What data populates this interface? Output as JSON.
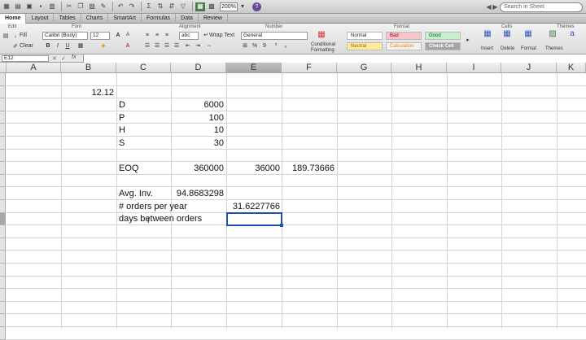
{
  "toolbar": {
    "zoom": "200%",
    "search_placeholder": "Search in Sheet",
    "help": "?"
  },
  "ribbon_tabs": [
    "Home",
    "Layout",
    "Tables",
    "Charts",
    "SmartArt",
    "Formulas",
    "Data",
    "Review"
  ],
  "ribbon": {
    "groups": {
      "edit": "Edit",
      "font": "Font",
      "alignment": "Alignment",
      "number": "Number",
      "format": "Format",
      "cells": "Cells",
      "themes": "Themes"
    },
    "fill_label": "Fill",
    "clear_label": "Clear",
    "font_name": "Calibri (Body)",
    "font_size": "12",
    "wrap_text": "Wrap Text",
    "number_format": "General",
    "conditional_formatting_1": "Conditional",
    "conditional_formatting_2": "Formatting",
    "styles": {
      "normal": "Normal",
      "bad": "Bad",
      "good": "Good",
      "neutral": "Neutral",
      "calculation": "Calculation",
      "check_cell": "Check Cell"
    },
    "insert": "Insert",
    "delete": "Delete",
    "format_btn": "Format",
    "themes_btn": "Themes",
    "abc": "abc",
    "align_label": "a",
    "bold": "B",
    "italic": "I",
    "underline": "U",
    "font_grow": "A",
    "font_shrink": "A",
    "font_color": "A",
    "percent": "%",
    "comma": "9",
    "fx": "fx",
    "style_color": "#e06b6b"
  },
  "name_box": "E12",
  "columns": [
    "A",
    "B",
    "C",
    "D",
    "E",
    "F",
    "G",
    "H",
    "I",
    "J",
    "K"
  ],
  "selected_column": "E",
  "cells": {
    "B3": "12.12",
    "C4": "D",
    "D4": "6000",
    "C5": "P",
    "D5": "100",
    "C6": "H",
    "D6": "10",
    "C7": "S",
    "D7": "30",
    "C9": "EOQ",
    "D9": "360000",
    "E9": "36000",
    "F9": "189.73666",
    "C11": "Avg. Inv.",
    "D11": "94.8683298",
    "C12": "# orders per year",
    "E12": "31.6227766",
    "C13": "days between orders"
  },
  "colors": {
    "accent": "#1f4db3",
    "selected_header": "#a8a8a8"
  }
}
